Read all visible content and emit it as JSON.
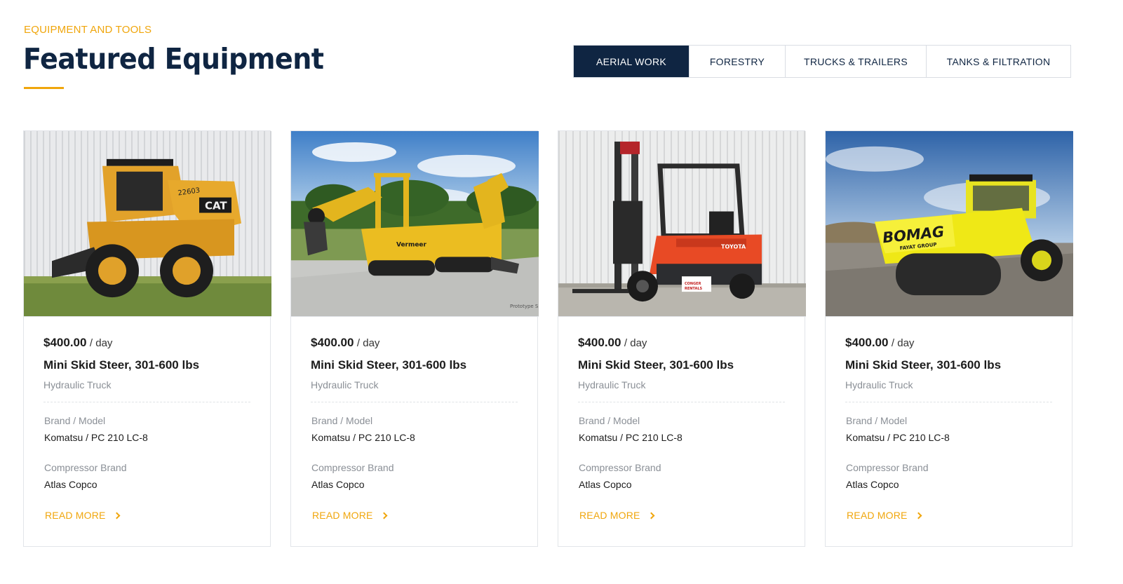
{
  "header": {
    "eyebrow": "EQUIPMENT AND TOOLS",
    "title": "Featured Equipment"
  },
  "tabs": [
    {
      "label": "AERIAL WORK",
      "active": true
    },
    {
      "label": "FORESTRY",
      "active": false
    },
    {
      "label": "TRUCKS & TRAILERS",
      "active": false
    },
    {
      "label": "TANKS & FILTRATION",
      "active": false
    }
  ],
  "cards": [
    {
      "image": {
        "subject": "skid-steer-loader",
        "brand_mark": "CAT",
        "unit_number": "22603"
      },
      "price": "$400.00",
      "price_unit": "/ day",
      "title": "Mini Skid Steer, 301-600 lbs",
      "subtitle": "Hydraulic Truck",
      "spec1_label": "Brand / Model",
      "spec1_value": "Komatsu / PC 210 LC-8",
      "spec2_label": "Compressor Brand",
      "spec2_value": "Atlas Copco",
      "cta": "READ MORE"
    },
    {
      "image": {
        "subject": "trencher-backhoe",
        "brand_mark": "Vermeer",
        "watermark": "Prototype Sh"
      },
      "price": "$400.00",
      "price_unit": "/ day",
      "title": "Mini Skid Steer, 301-600 lbs",
      "subtitle": "Hydraulic Truck",
      "spec1_label": "Brand / Model",
      "spec1_value": "Komatsu / PC 210 LC-8",
      "spec2_label": "Compressor Brand",
      "spec2_value": "Atlas Copco",
      "cta": "READ MORE"
    },
    {
      "image": {
        "subject": "forklift",
        "brand_mark": "TOYOTA",
        "decal": "CONGER RENTALS"
      },
      "price": "$400.00",
      "price_unit": "/ day",
      "title": "Mini Skid Steer, 301-600 lbs",
      "subtitle": "Hydraulic Truck",
      "spec1_label": "Brand / Model",
      "spec1_value": "Komatsu / PC 210 LC-8",
      "spec2_label": "Compressor Brand",
      "spec2_value": "Atlas Copco",
      "cta": "READ MORE"
    },
    {
      "image": {
        "subject": "road-roller",
        "brand_mark": "BOMAG",
        "sub_mark": "FAYAT GROUP"
      },
      "price": "$400.00",
      "price_unit": "/ day",
      "title": "Mini Skid Steer, 301-600 lbs",
      "subtitle": "Hydraulic Truck",
      "spec1_label": "Brand / Model",
      "spec1_value": "Komatsu / PC 210 LC-8",
      "spec2_label": "Compressor Brand",
      "spec2_value": "Atlas Copco",
      "cta": "READ MORE"
    }
  ],
  "colors": {
    "accent": "#f0a60c",
    "navy": "#0f2542",
    "muted_text": "#8a8f96",
    "border": "#e2e5e9"
  }
}
